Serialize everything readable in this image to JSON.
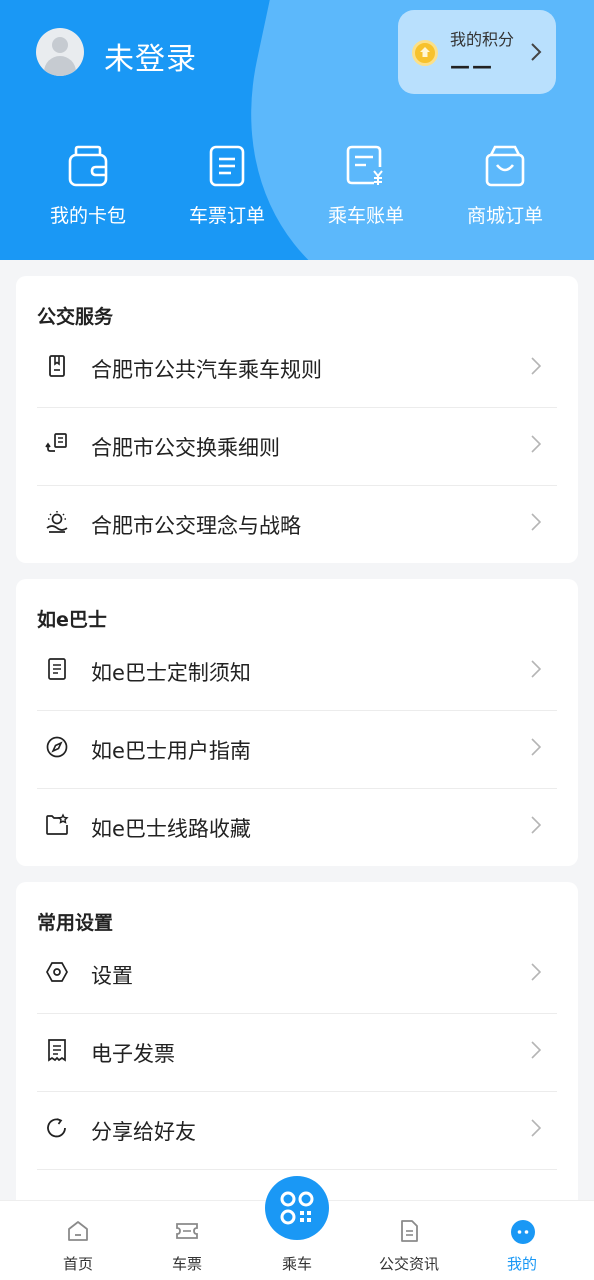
{
  "header": {
    "username": "未登录",
    "points_label": "我的积分",
    "points_value": "——",
    "quick_links": [
      {
        "label": "我的卡包",
        "icon": "wallet-icon"
      },
      {
        "label": "车票订单",
        "icon": "ticket-order-icon"
      },
      {
        "label": "乘车账单",
        "icon": "bill-icon"
      },
      {
        "label": "商城订单",
        "icon": "shopping-bag-icon"
      }
    ]
  },
  "sections": [
    {
      "title": "公交服务",
      "items": [
        {
          "label": "合肥市公共汽车乘车规则",
          "icon": "rulebook-icon"
        },
        {
          "label": "合肥市公交换乘细则",
          "icon": "transfer-icon"
        },
        {
          "label": "合肥市公交理念与战略",
          "icon": "idea-icon"
        }
      ]
    },
    {
      "title": "如e巴士",
      "items": [
        {
          "label": "如e巴士定制须知",
          "icon": "notice-icon"
        },
        {
          "label": "如e巴士用户指南",
          "icon": "compass-icon"
        },
        {
          "label": "如e巴士线路收藏",
          "icon": "favorite-folder-icon"
        }
      ]
    },
    {
      "title": "常用设置",
      "items": [
        {
          "label": "设置",
          "icon": "settings-icon"
        },
        {
          "label": "电子发票",
          "icon": "invoice-icon"
        },
        {
          "label": "分享给好友",
          "icon": "share-icon"
        }
      ]
    }
  ],
  "tabbar": {
    "tabs": [
      {
        "label": "首页",
        "icon": "home-icon"
      },
      {
        "label": "车票",
        "icon": "ticket-icon"
      },
      {
        "label": "乘车",
        "icon": "qr-code-icon"
      },
      {
        "label": "公交资讯",
        "icon": "news-icon"
      },
      {
        "label": "我的",
        "icon": "profile-icon"
      }
    ],
    "active": "我的"
  },
  "colors": {
    "primary": "#1a98f5",
    "header_light": "#5cb8fb",
    "points_bg": "#b9e0fd",
    "coin": "#f7c22d"
  }
}
